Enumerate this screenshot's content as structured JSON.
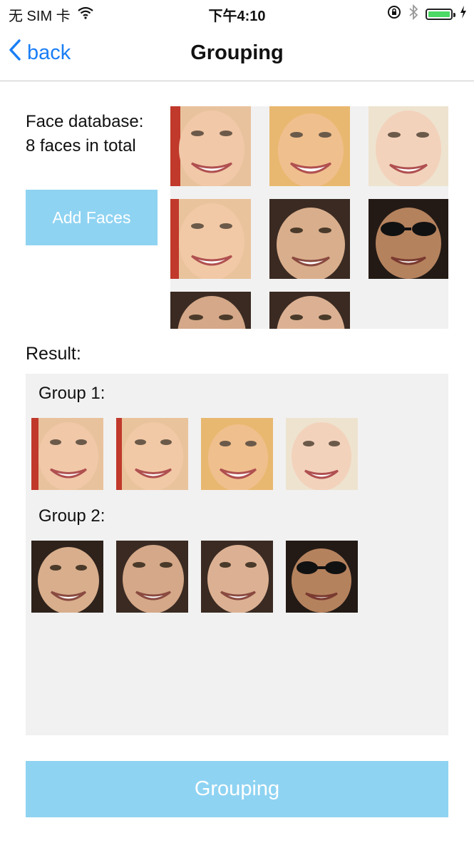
{
  "status_bar": {
    "carrier": "无 SIM 卡",
    "time": "下午4:10"
  },
  "nav": {
    "back_label": "back",
    "title": "Grouping"
  },
  "database": {
    "label_line1": "Face database:",
    "label_line2": "8 faces in total",
    "add_button": "Add Faces"
  },
  "result": {
    "label": "Result:",
    "groups": [
      {
        "title": "Group 1:"
      },
      {
        "title": "Group 2:"
      }
    ]
  },
  "grouping_button": "Grouping",
  "colors": {
    "accent_blue": "#1a7ef5",
    "button_blue": "#8fd3f2",
    "panel_gray": "#f1f1f1",
    "battery_green": "#4cd964"
  }
}
